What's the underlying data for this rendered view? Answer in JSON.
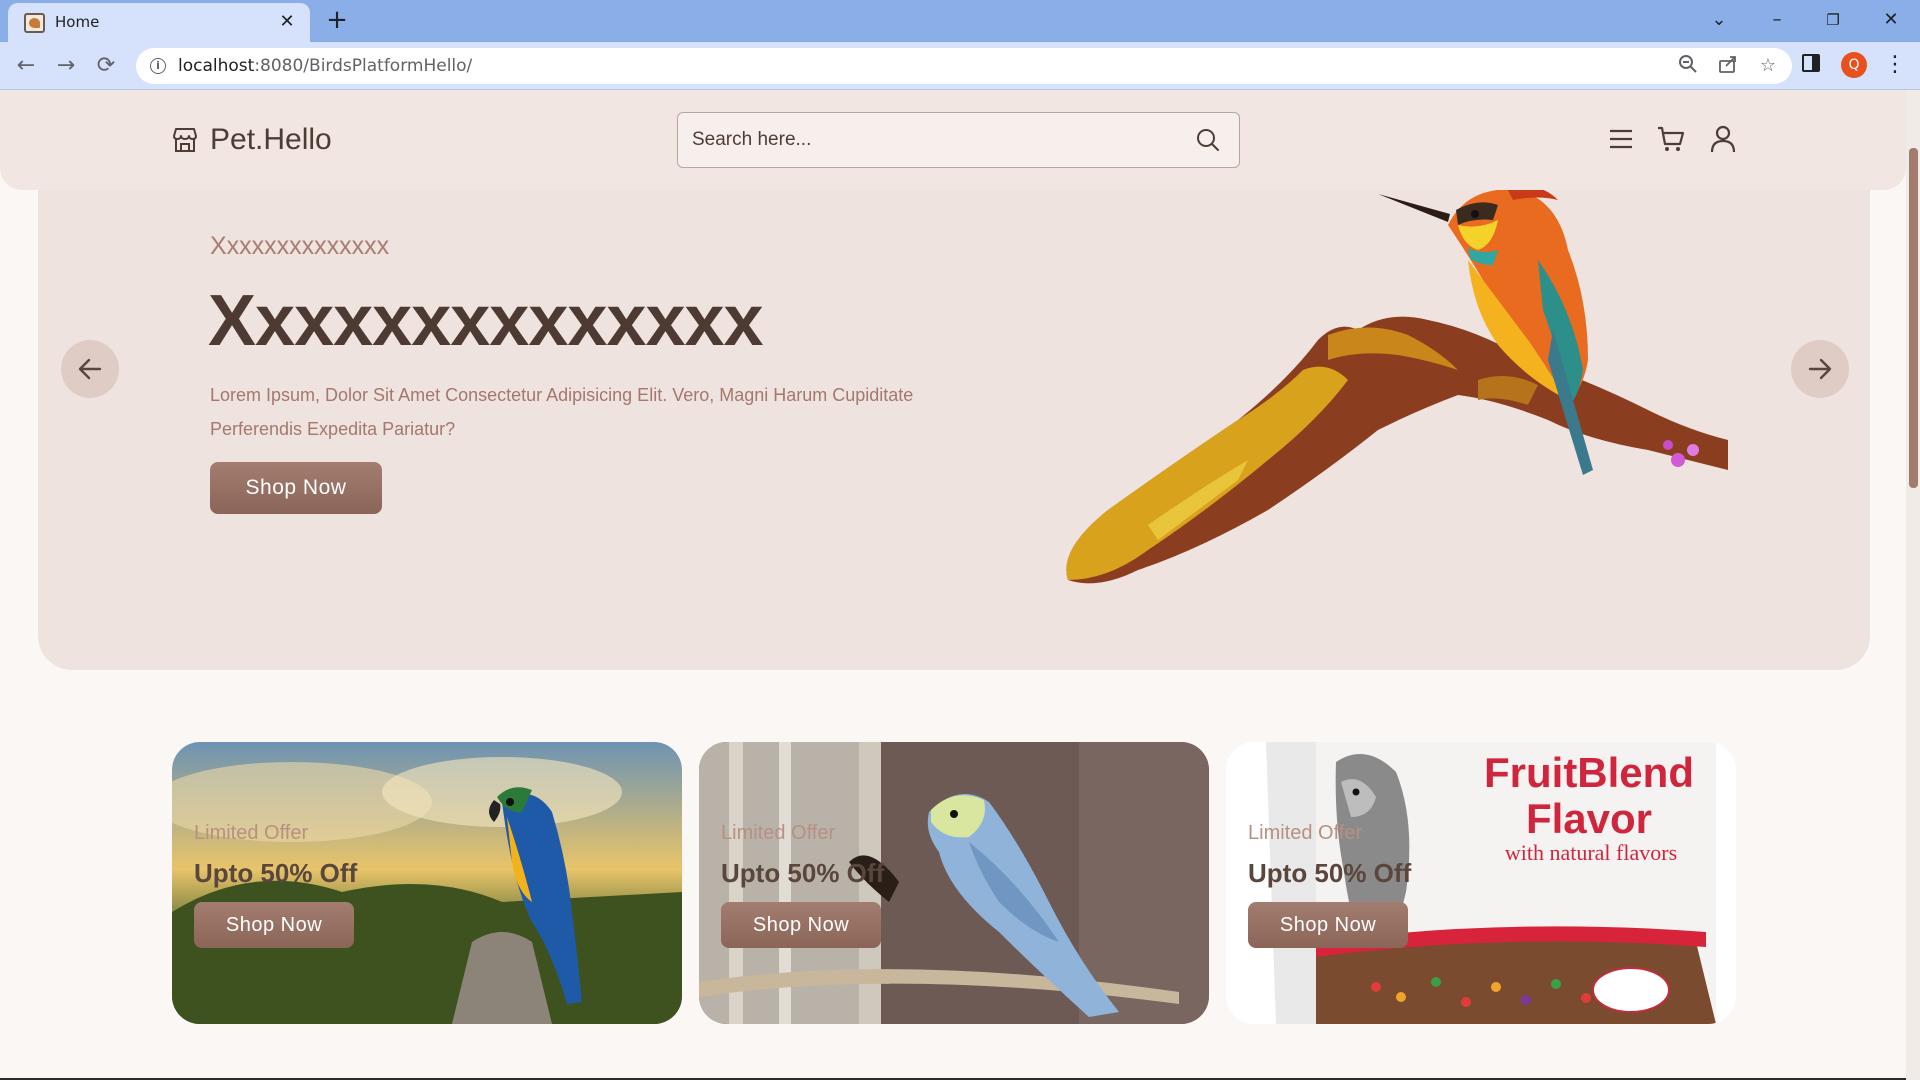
{
  "browser": {
    "tab_title": "Home",
    "url_host": "localhost",
    "url_rest": ":8080/BirdsPlatformHello/",
    "profile_initial": "Q"
  },
  "site": {
    "brand": "Pet.Hello",
    "search_placeholder": "Search here..."
  },
  "hero": {
    "subtitle": "Xxxxxxxxxxxxxx",
    "title": "Xxxxxxxxxxxxxx",
    "description": "Lorem Ipsum, Dolor Sit Amet Consectetur Adipisicing Elit. Vero, Magni Harum Cupiditate Perferendis Expedita Pariatur?",
    "button": "Shop Now"
  },
  "promos": [
    {
      "label": "Limited Offer",
      "offer": "Upto 50% Off",
      "button": "Shop Now"
    },
    {
      "label": "Limited Offer",
      "offer": "Upto 50% Off",
      "button": "Shop Now"
    },
    {
      "label": "Limited Offer",
      "offer": "Upto 50% Off",
      "button": "Shop Now",
      "packaging_title": "FruitBlend Flavor",
      "packaging_sub": "with natural flavors"
    }
  ],
  "colors": {
    "accent": "#9a7466",
    "header_bg": "#f1e6e2",
    "text_dark": "#4d3b33"
  }
}
